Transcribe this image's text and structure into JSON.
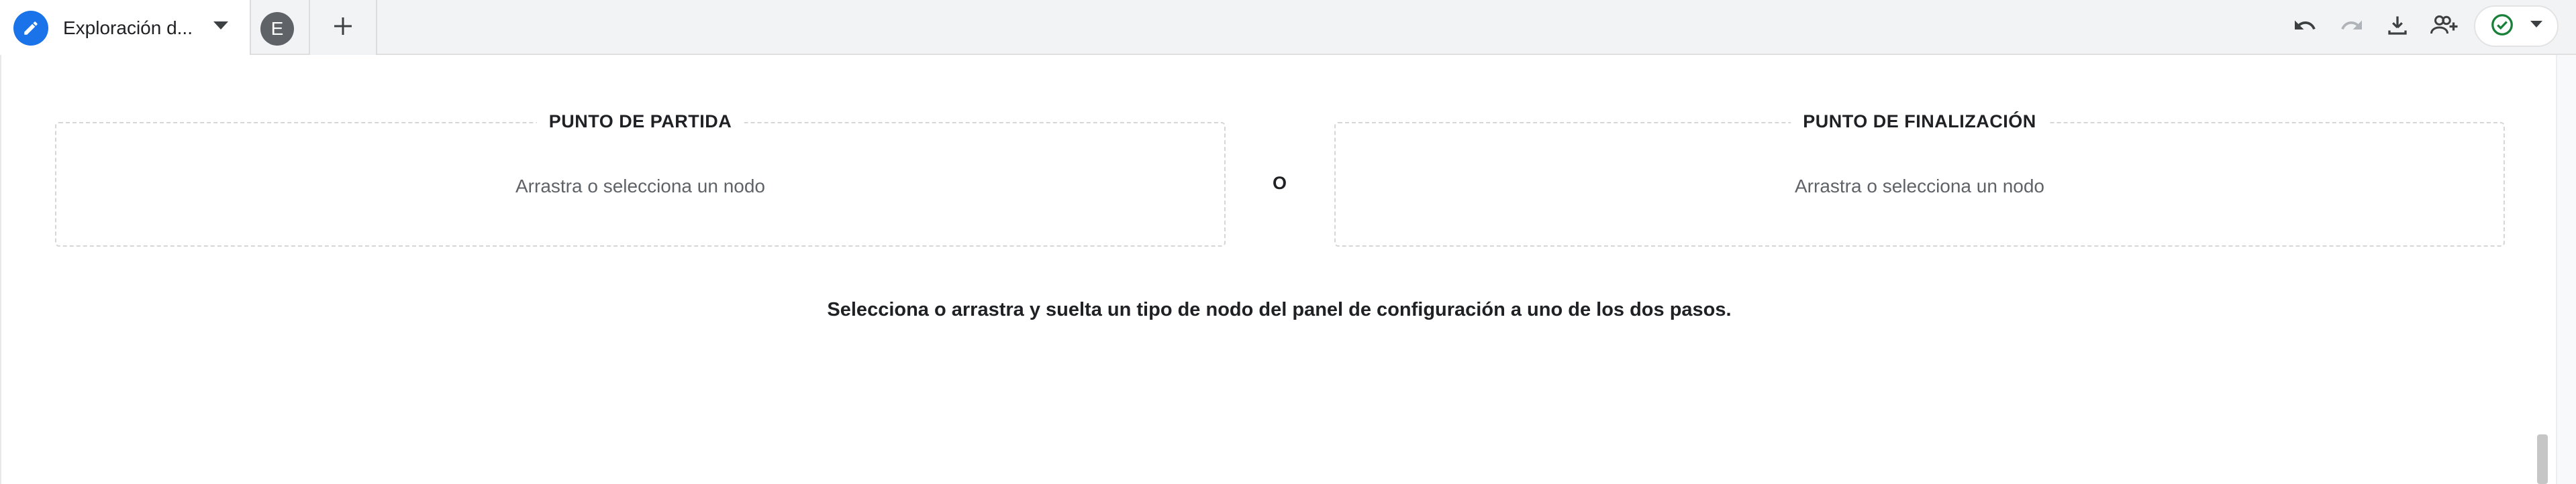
{
  "tabs": {
    "active_title": "Exploración d...",
    "secondary_initial": "E"
  },
  "canvas": {
    "start": {
      "label": "PUNTO DE PARTIDA",
      "hint": "Arrastra o selecciona un nodo"
    },
    "or_label": "O",
    "end": {
      "label": "PUNTO DE FINALIZACIÓN",
      "hint": "Arrastra o selecciona un nodo"
    },
    "instruction": "Selecciona o arrastra y suelta un tipo de nodo del panel de configuración a uno de los dos pasos."
  },
  "icons": {
    "edit": "pencil-icon",
    "tab_menu": "caret-down-icon",
    "add_tab": "plus-icon",
    "undo": "undo-icon",
    "redo": "redo-icon",
    "download": "download-icon",
    "share": "add-person-icon",
    "status": "check-circle-icon",
    "status_menu": "caret-down-icon"
  },
  "colors": {
    "accent": "#1a73e8",
    "status_ok": "#188038",
    "initial_avatar": "#5f6368"
  }
}
